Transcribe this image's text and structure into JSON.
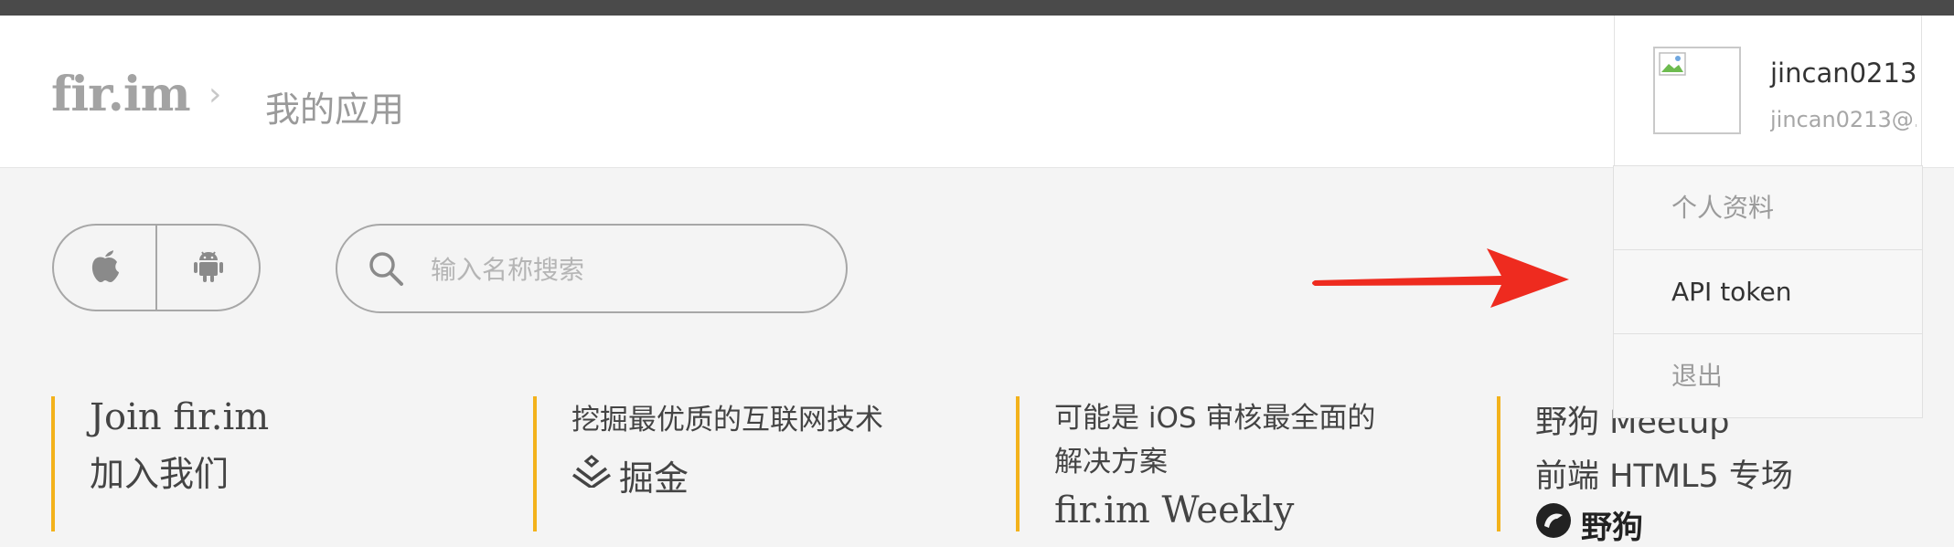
{
  "header": {
    "logo": "fir.im",
    "breadcrumb_separator": "›",
    "page_title": "我的应用"
  },
  "filters": {
    "platform_ios": "apple-icon",
    "platform_android": "android-icon"
  },
  "search": {
    "placeholder": "输入名称搜索",
    "value": ""
  },
  "user": {
    "username": "jincan0213",
    "email_truncated": "jincan0213@..."
  },
  "user_menu": {
    "items": [
      "个人资料",
      "API token",
      "退出"
    ]
  },
  "cards": [
    {
      "line1": "Join fir.im",
      "line2": "加入我们"
    },
    {
      "line1": "挖掘最优质的互联网技术",
      "brand": "掘金"
    },
    {
      "line1": "可能是 iOS 审核最全面的",
      "line2": "解决方案",
      "line3": "fir.im Weekly"
    },
    {
      "line1": "野狗 Meetup",
      "line2": "前端 HTML5 专场",
      "brand": "野狗"
    }
  ],
  "colors": {
    "accent_yellow": "#f3b21b",
    "arrow_red": "#ee2b1f",
    "logo_gray": "#a3a3a3"
  }
}
